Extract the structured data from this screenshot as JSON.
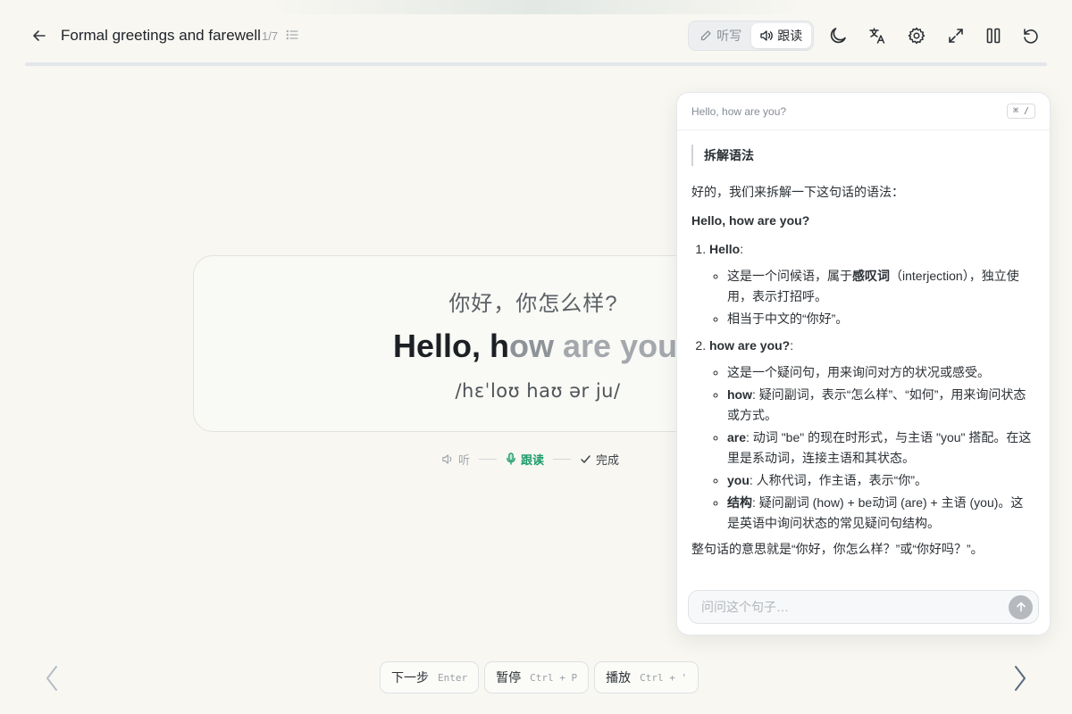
{
  "header": {
    "title": "Formal greetings and farewell",
    "progress": "1/7",
    "modes": [
      {
        "label": "听写",
        "icon": "pencil-icon",
        "active": false
      },
      {
        "label": "跟读",
        "icon": "speaker-icon",
        "active": true
      }
    ],
    "tools": [
      "moon-icon",
      "translate-icon",
      "gear-icon",
      "expand-icon",
      "columns-icon",
      "reset-icon"
    ]
  },
  "card": {
    "translation": "你好，你怎么样?",
    "sentence_done": "Hello, h",
    "sentence_fade": "ow",
    "sentence_rest": " are you?",
    "phonetic": "/hɛˈloʊ haʊ ər ju/"
  },
  "steps": [
    {
      "label": "听",
      "state": "muted",
      "icon": "speaker-icon"
    },
    {
      "label": "跟读",
      "state": "active",
      "icon": "microphone-icon"
    },
    {
      "label": "完成",
      "state": "next",
      "icon": "check-icon"
    }
  ],
  "panel": {
    "sentence": "Hello, how are you?",
    "shortcut": "⌘ /",
    "section_label": "拆解语法",
    "intro": "好的，我们来拆解一下这句话的语法：",
    "heading": "Hello, how are you?",
    "items": [
      {
        "term": "Hello",
        "points": [
          {
            "pre": "这是一个问候语，属于",
            "bold": "感叹词",
            "post": "（interjection），独立使用，表示打招呼。"
          },
          {
            "pre": "相当于中文的“你好”。",
            "bold": "",
            "post": ""
          }
        ]
      },
      {
        "term": "how are you?",
        "points": [
          {
            "pre": "这是一个疑问句，用来询问对方的状况或感受。",
            "bold": "",
            "post": ""
          },
          {
            "pre": "",
            "bold": "how",
            "post": ": 疑问副词，表示“怎么样”、“如何”，用来询问状态或方式。"
          },
          {
            "pre": "",
            "bold": "are",
            "post": ": 动词 \"be\" 的现在时形式，与主语 \"you\" 搭配。在这里是系动词，连接主语和其状态。"
          },
          {
            "pre": "",
            "bold": "you",
            "post": ": 人称代词，作主语，表示“你”。"
          },
          {
            "pre": "",
            "bold": "结构",
            "post": ": 疑问副词 (how) + be动词 (are) + 主语 (you)。这是英语中询问状态的常见疑问句结构。"
          }
        ]
      }
    ],
    "summary": "整句话的意思就是“你好，你怎么样？”或“你好吗？”。",
    "input_placeholder": "问问这个句子…"
  },
  "bottom": {
    "actions": [
      {
        "label": "下一步",
        "kbd": "Enter"
      },
      {
        "label": "暂停",
        "kbd": "Ctrl + P"
      },
      {
        "label": "播放",
        "kbd": "Ctrl + '"
      }
    ]
  },
  "colors": {
    "accent_green": "#1f9d6c",
    "background": "#f8f7f2"
  }
}
